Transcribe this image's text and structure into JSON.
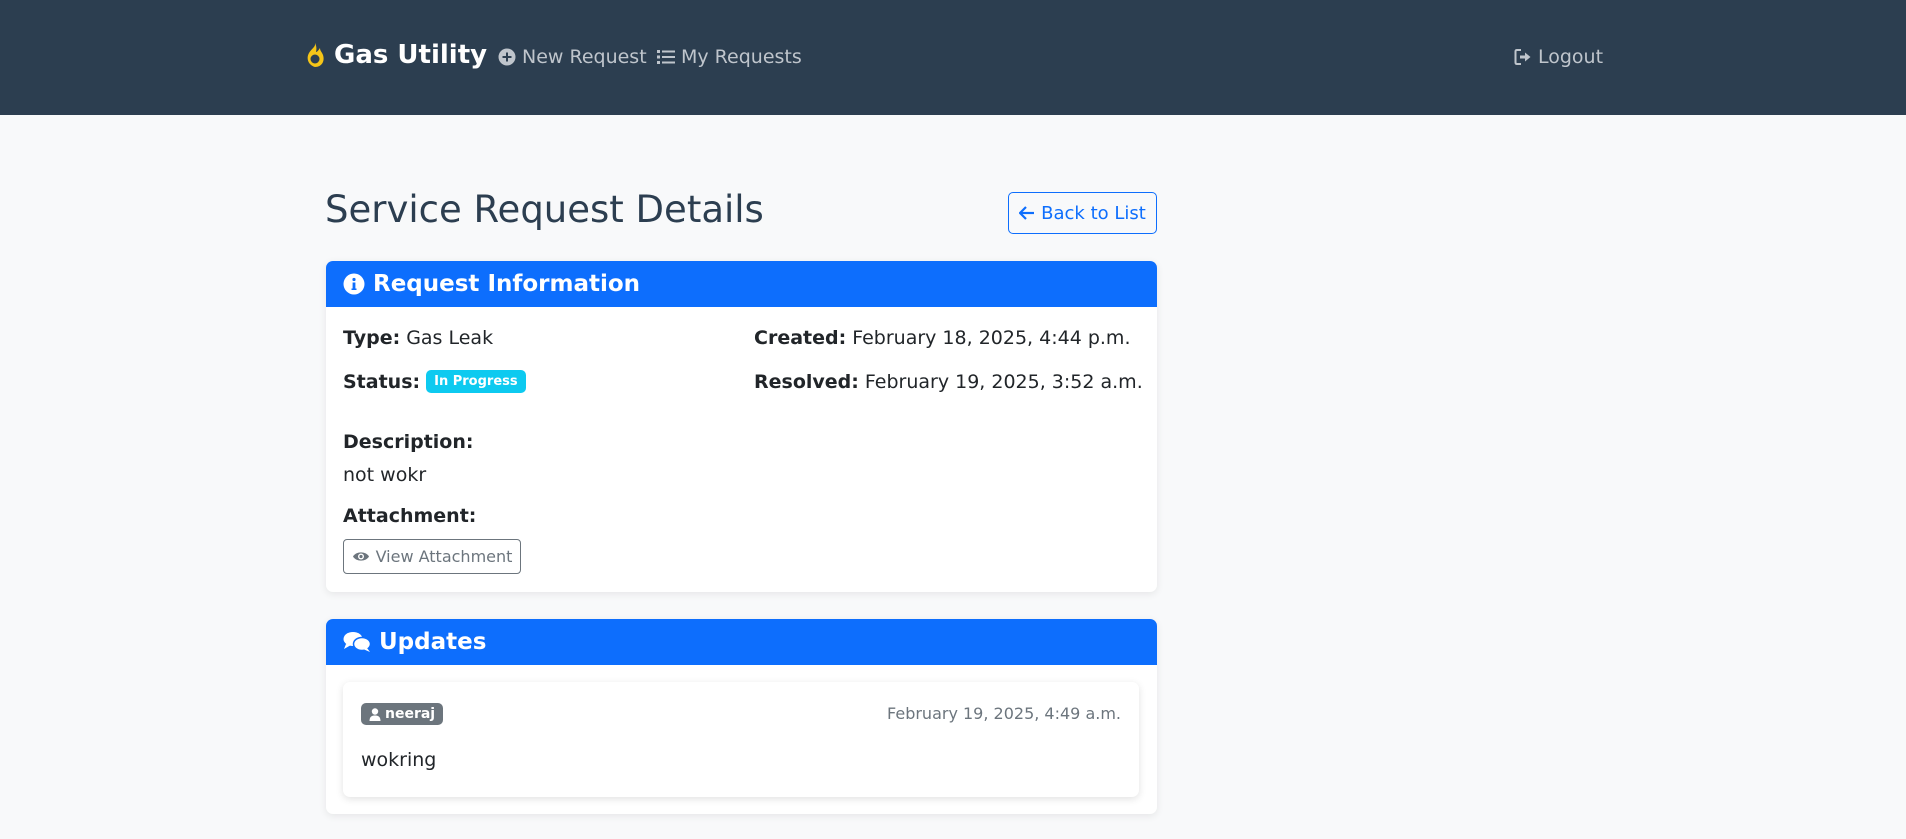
{
  "navbar": {
    "brand": "Gas Utility",
    "new_request": "New Request",
    "my_requests": "My Requests",
    "logout": "Logout"
  },
  "page": {
    "title": "Service Request Details",
    "back_button": "Back to List"
  },
  "request_info": {
    "header": "Request Information",
    "type_label": "Type:",
    "type_value": "Gas Leak",
    "status_label": "Status:",
    "status_value": "In Progress",
    "created_label": "Created:",
    "created_value": "February 18, 2025, 4:44 p.m.",
    "resolved_label": "Resolved:",
    "resolved_value": "February 19, 2025, 3:52 a.m.",
    "description_label": "Description:",
    "description_value": "not wokr",
    "attachment_label": "Attachment:",
    "view_attachment": "View Attachment"
  },
  "updates": {
    "header": "Updates",
    "items": [
      {
        "user": "neeraj",
        "timestamp": "February 19, 2025, 4:49 a.m.",
        "message": "wokring"
      }
    ]
  },
  "colors": {
    "navbar_bg": "#2c3e50",
    "primary": "#0d6efd",
    "status_badge": "#0dcaf0",
    "user_badge": "#6c757d",
    "brand_icon": "#f5c518"
  },
  "icons": {
    "brand": "fire-icon",
    "new_request": "plus-circle-icon",
    "my_requests": "list-icon",
    "logout": "sign-out-icon",
    "back": "arrow-left-icon",
    "info": "info-circle-icon",
    "view": "eye-icon",
    "updates": "comments-icon",
    "user": "user-icon"
  }
}
